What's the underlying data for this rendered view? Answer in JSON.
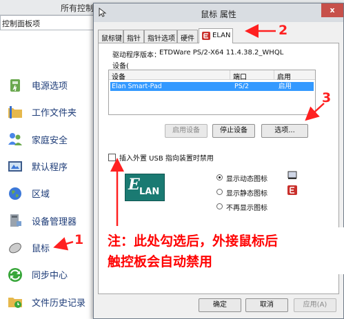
{
  "background_window": {
    "title": "所有控制面板项",
    "address": "控制面板项",
    "items": [
      {
        "label": "电源选项",
        "icon": "power-options-icon"
      },
      {
        "label": "工作文件夹",
        "icon": "work-folders-icon"
      },
      {
        "label": "家庭安全",
        "icon": "family-safety-icon"
      },
      {
        "label": "默认程序",
        "icon": "default-programs-icon"
      },
      {
        "label": "区域",
        "icon": "region-globe-icon"
      },
      {
        "label": "设备管理器",
        "icon": "device-manager-icon"
      },
      {
        "label": "鼠标",
        "icon": "mouse-icon"
      },
      {
        "label": "同步中心",
        "icon": "sync-center-icon"
      },
      {
        "label": "文件历史记录",
        "icon": "file-history-icon"
      }
    ]
  },
  "dialog": {
    "title": "鼠标 属性",
    "close_label": "x",
    "tabs": [
      {
        "label": "鼠标键"
      },
      {
        "label": "指针"
      },
      {
        "label": "指针选项"
      },
      {
        "label": "硬件"
      },
      {
        "label": "ELAN",
        "active": true
      }
    ],
    "driver_label": "驱动程序版本：",
    "driver_version": "ETDWare PS/2-X64 11.4.38.2_WHQL",
    "devices_label": "设备(",
    "device_table": {
      "headers": [
        "设备",
        "端口",
        "启用"
      ],
      "rows": [
        {
          "device": "Elan Smart-Pad",
          "port": "PS/2",
          "enabled": "启用"
        }
      ]
    },
    "buttons": {
      "enable": "启用设备",
      "disable": "停止设备",
      "options": "选项..."
    },
    "usb_checkbox_label": "插入外置 USB 指向装置时禁用",
    "usb_checkbox_checked": false,
    "logo_text": "LAN",
    "logo_letter": "E",
    "tray_icon_options": [
      {
        "label": "显示动态图标",
        "checked": true
      },
      {
        "label": "显示静态图标",
        "checked": false
      },
      {
        "label": "不再显示图标",
        "checked": false
      }
    ],
    "footer_buttons": {
      "ok": "确定",
      "cancel": "取消",
      "apply": "应用(A)"
    }
  },
  "annotations": {
    "note_line1": "注：此处勾选后，外接鼠标后",
    "note_line2": "触控板会自动禁用",
    "num1": "1",
    "num2": "2",
    "num3": "3",
    "color": "#ff0000"
  }
}
